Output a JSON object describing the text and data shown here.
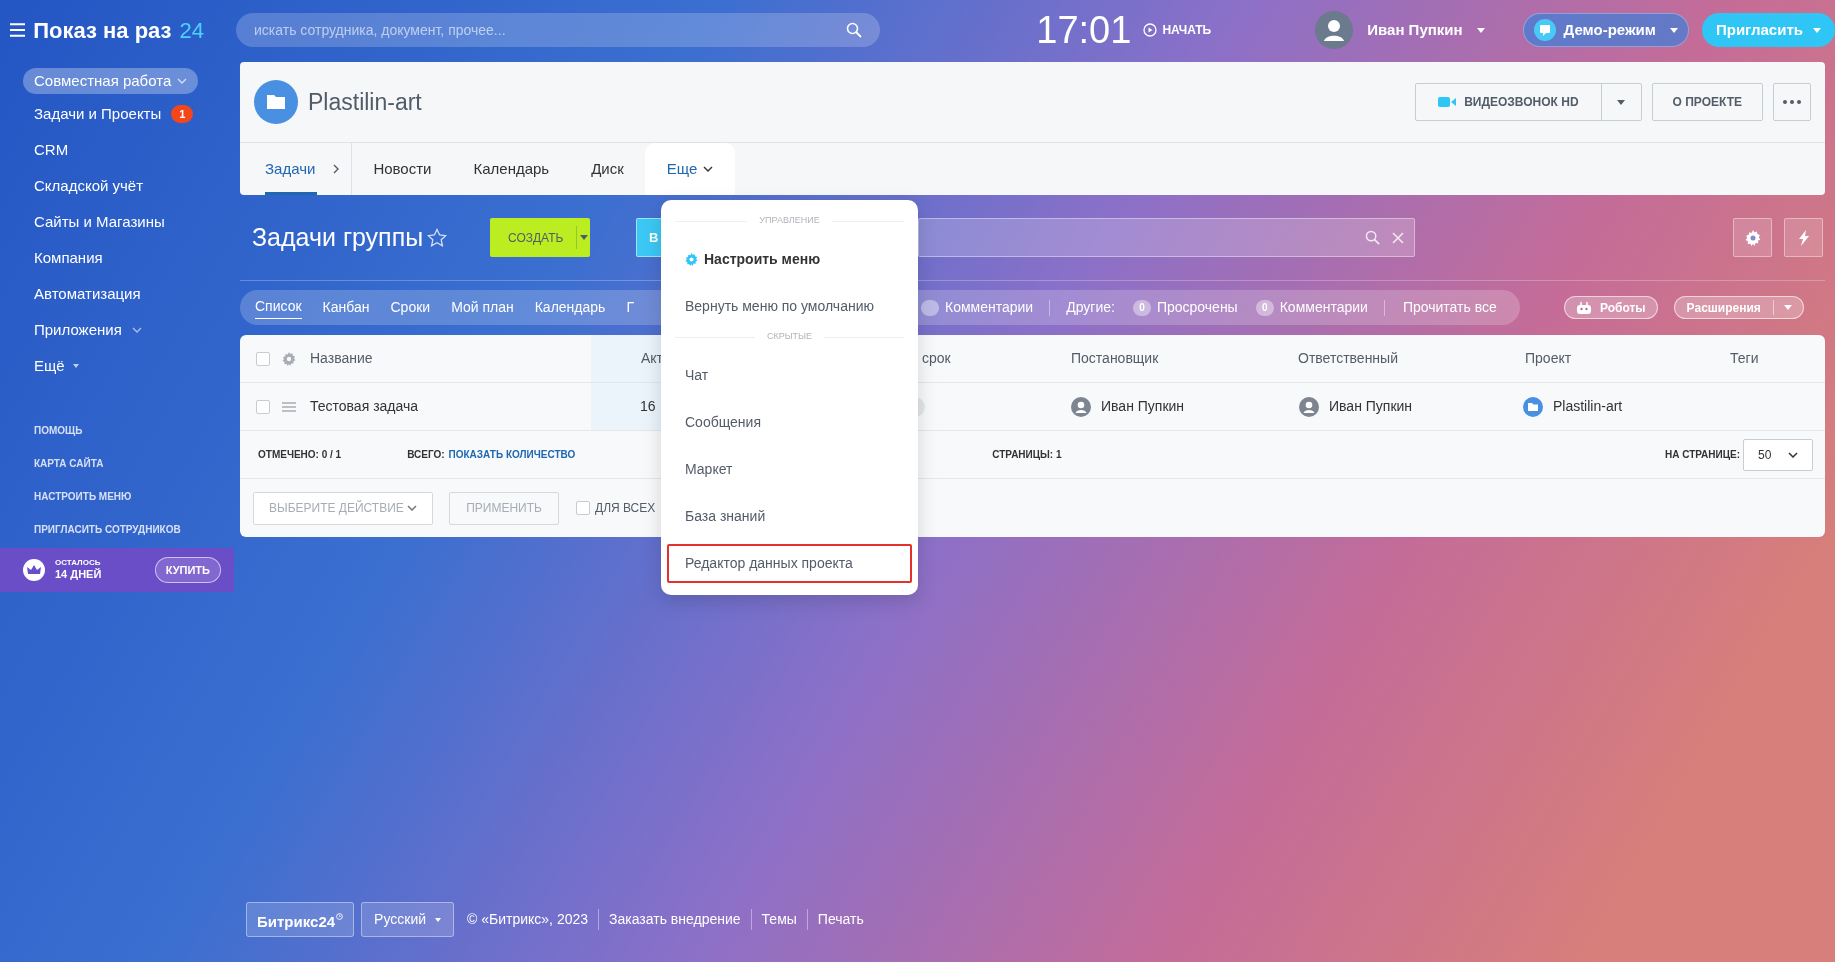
{
  "topbar": {
    "logo": "Показ на раз",
    "logo_accent": "24",
    "search": {
      "placeholder": "искать сотрудника, документ, прочее..."
    },
    "clock": "17:01",
    "start": "НАЧАТЬ",
    "user": "Иван Пупкин",
    "demo": "Демо-режим",
    "invite": "Пригласить"
  },
  "sidebar": {
    "group": "Совместная работа",
    "items": [
      {
        "label": "Задачи и Проекты",
        "kind": "plain",
        "badge": "1"
      },
      {
        "label": "CRM",
        "kind": "plain"
      },
      {
        "label": "Складской учёт",
        "kind": "plain"
      },
      {
        "label": "Сайты и Магазины",
        "kind": "plain"
      },
      {
        "label": "Компания",
        "kind": "plain"
      },
      {
        "label": "Автоматизация",
        "kind": "plain"
      },
      {
        "label": "Приложения",
        "kind": "submenu"
      },
      {
        "label": "Ещё",
        "kind": "more"
      }
    ],
    "links": [
      "ПОМОЩЬ",
      "КАРТА САЙТА",
      "НАСТРОИТЬ МЕНЮ",
      "ПРИГЛАСИТЬ СОТРУДНИКОВ"
    ],
    "trial": {
      "label": "ОСТАЛОСЬ",
      "days": "14 ДНЕЙ",
      "button": "КУПИТЬ"
    }
  },
  "project": {
    "title": "Plastilin-art",
    "video_button": "ВИДЕОЗВОНОК HD",
    "about_button": "О ПРОЕКТЕ",
    "tabs": [
      {
        "label": "Задачи",
        "selected": true,
        "kind": "arrow"
      },
      {
        "label": "Новости",
        "selected": false,
        "kind": "plain"
      },
      {
        "label": "Календарь",
        "selected": false,
        "kind": "plain"
      },
      {
        "label": "Диск",
        "selected": false,
        "kind": "plain"
      },
      {
        "label": "Еще",
        "selected": false,
        "kind": "more"
      }
    ]
  },
  "menu": {
    "open": true,
    "sections": [
      {
        "title": "УПРАВЛЕНИЕ",
        "items": [
          {
            "label": "Настроить меню",
            "kind": "settings",
            "highlighted": false
          },
          {
            "label": "Вернуть меню по умолчанию",
            "kind": "plain",
            "highlighted": false
          }
        ]
      },
      {
        "title": "СКРЫТЫЕ",
        "items": [
          {
            "label": "Чат",
            "kind": "plain",
            "highlighted": false
          },
          {
            "label": "Сообщения",
            "kind": "plain",
            "highlighted": false
          },
          {
            "label": "Маркет",
            "kind": "plain",
            "highlighted": false
          },
          {
            "label": "База знаний",
            "kind": "plain",
            "highlighted": false
          },
          {
            "label": "Редактор данных проекта",
            "kind": "plain",
            "highlighted": true
          }
        ]
      }
    ]
  },
  "tasks": {
    "title": "Задачи группы",
    "starred": false,
    "create_button": "СОЗДАТЬ",
    "second_button": "В",
    "views": [
      {
        "label": "Список",
        "selected": true
      },
      {
        "label": "Канбан",
        "selected": false
      },
      {
        "label": "Сроки",
        "selected": false
      },
      {
        "label": "Мой план",
        "selected": false
      },
      {
        "label": "Календарь",
        "selected": false
      },
      {
        "label": "Г",
        "selected": false
      }
    ],
    "counters": [
      {
        "kind": "counter",
        "label": "Комментарии"
      },
      {
        "kind": "group",
        "label": "Другие:"
      },
      {
        "kind": "counter",
        "count": "0",
        "label": "Просрочены"
      },
      {
        "kind": "counter",
        "count": "0",
        "label": "Комментарии"
      },
      {
        "kind": "action",
        "label": "Прочитать все"
      }
    ],
    "robots_button": "Роботы",
    "extensions_button": "Расширения",
    "table": {
      "all_checked": false,
      "columns": [
        "Название",
        "Акт",
        "срок",
        "Постановщик",
        "Ответственный",
        "Проект",
        "Теги"
      ],
      "rows": [
        {
          "checked": false,
          "title": "Тестовая задача",
          "column_3": "16",
          "creator": "Иван Пупкин",
          "responsible": "Иван Пупкин",
          "project": "Plastilin-art"
        }
      ]
    },
    "summary": {
      "selected": "ОТМЕЧЕНО: 0 / 1",
      "total_label": "ВСЕГО:",
      "total_link": "ПОКАЗАТЬ КОЛИЧЕСТВО",
      "pages": "СТРАНИЦЫ: 1",
      "per_page_label": "НА СТРАНИЦЕ:",
      "per_page": "50"
    },
    "actions": {
      "action_select": "ВЫБЕРИТЕ ДЕЙСТВИЕ",
      "apply": "ПРИМЕНИТЬ",
      "for_all": {
        "label": "ДЛЯ ВСЕХ",
        "checked": false
      }
    }
  },
  "footer": {
    "logo": "Битрикс24",
    "language": "Русский",
    "copyright": "© «Битрикс», 2023",
    "links": [
      "Заказать внедрение",
      "Темы",
      "Печать"
    ]
  }
}
